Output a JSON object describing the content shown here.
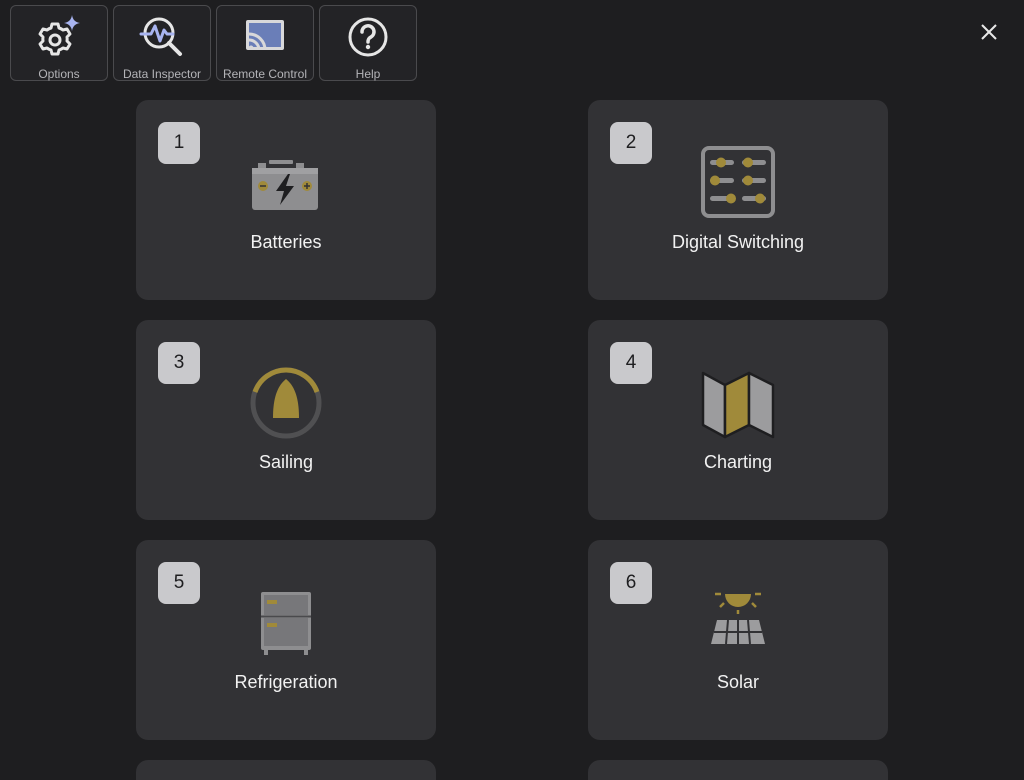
{
  "toolbar": {
    "buttons": [
      {
        "label": "Options",
        "icon": "gear-sparkle-icon"
      },
      {
        "label": "Data Inspector",
        "icon": "data-inspector-icon"
      },
      {
        "label": "Remote Control",
        "icon": "cast-icon"
      },
      {
        "label": "Help",
        "icon": "help-icon"
      }
    ]
  },
  "close": {
    "icon": "close-icon"
  },
  "colors": {
    "background": "#1e1e20",
    "card": "#323235",
    "badge": "#c9c9cc",
    "accent_gold": "#a08a3a",
    "icon_gray": "#8e8e90",
    "options_sparkle": "#a8b4f0"
  },
  "cards": [
    {
      "number": "1",
      "title": "Batteries",
      "icon": "battery-icon"
    },
    {
      "number": "2",
      "title": "Digital Switching",
      "icon": "switch-panel-icon"
    },
    {
      "number": "3",
      "title": "Sailing",
      "icon": "sailing-icon"
    },
    {
      "number": "4",
      "title": "Charting",
      "icon": "chart-map-icon"
    },
    {
      "number": "5",
      "title": "Refrigeration",
      "icon": "refrigerator-icon"
    },
    {
      "number": "6",
      "title": "Solar",
      "icon": "solar-panel-icon"
    }
  ]
}
